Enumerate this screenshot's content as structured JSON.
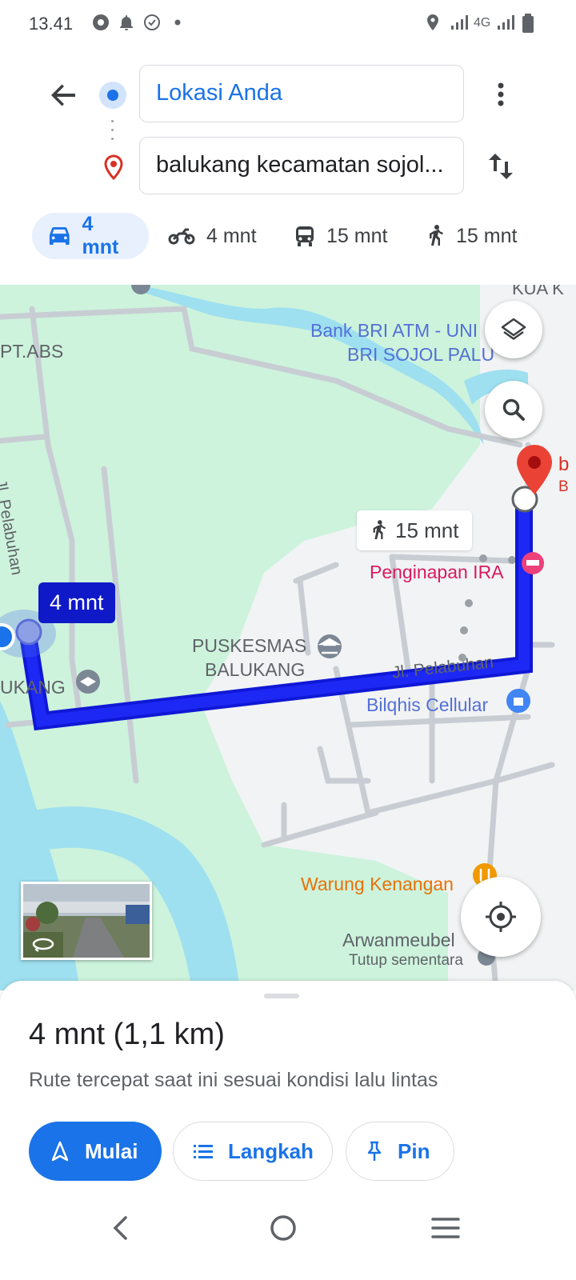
{
  "status_bar": {
    "time": "13.41",
    "network": "4G",
    "icons": [
      "chrome-icon",
      "notification-bell-icon",
      "check-badge-icon",
      "dot-icon",
      "location-icon",
      "signal-icon",
      "signal-icon",
      "battery-icon"
    ]
  },
  "directions": {
    "origin": "Lokasi Anda",
    "destination": "balukang kecamatan sojol...",
    "modes": [
      {
        "icon": "car-icon",
        "label": "4 mnt",
        "active": true
      },
      {
        "icon": "motorcycle-icon",
        "label": "4 mnt",
        "active": false
      },
      {
        "icon": "transit-icon",
        "label": "15 mnt",
        "active": false
      },
      {
        "icon": "walk-icon",
        "label": "15 mnt",
        "active": false
      }
    ]
  },
  "map": {
    "labels": {
      "pt_abs": "PT.ABS",
      "bank_line1": "Bank BRI ATM - UNI",
      "bank_line2": "BRI SOJOL PALU",
      "top_road": "KUA K",
      "jl_pelabuhan_vertical": "Jl. Pelabuhan",
      "penginapan": "Penginapan IRA",
      "puskesmas_line1": "PUSKESMAS",
      "puskesmas_line2": "BALUKANG",
      "school": "UKANG",
      "jl_pelabuhan": "Jl. Pelabuhan",
      "bilqhis": "Bilqhis Cellular",
      "warung": "Warung Kenangan",
      "arwan": "Arwanmeubel",
      "arwan_status": "Tutup sementara",
      "dest_label_1": "b",
      "dest_label_2": "B"
    },
    "route_time_bubble": "4 mnt",
    "walk_bubble": "15 mnt",
    "colors": {
      "route": "#1a1ff0",
      "land": "#cdf3dc",
      "water": "#9ee0f0",
      "urban": "#f1f3f4"
    }
  },
  "sheet": {
    "summary": "4 mnt (1,1 km)",
    "subtitle": "Rute tercepat saat ini sesuai kondisi lalu lintas",
    "start_label": "Mulai",
    "steps_label": "Langkah",
    "pin_label": "Pin"
  },
  "nav_bar": {
    "icons": [
      "back-nav-icon",
      "home-nav-icon",
      "recents-nav-icon"
    ]
  }
}
